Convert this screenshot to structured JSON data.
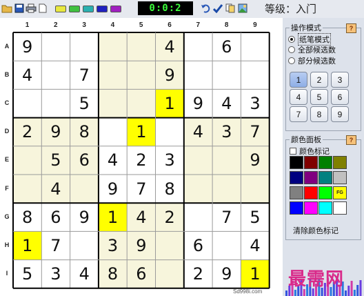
{
  "toolbar": {
    "icons": [
      "open-folder-icon",
      "save-icon",
      "print-icon",
      "new-page-icon"
    ],
    "swatches": [
      "#e8e840",
      "#40c040",
      "#2ab0b0",
      "#2020c0",
      "#a020c0"
    ],
    "tools": [
      "undo-icon",
      "check-icon",
      "copy-icon",
      "image-icon"
    ]
  },
  "timer": {
    "value": "0:0:2"
  },
  "level": {
    "text": "等级：入门"
  },
  "board": {
    "col_labels": [
      "1",
      "2",
      "3",
      "4",
      "5",
      "6",
      "7",
      "8",
      "9"
    ],
    "row_labels": [
      "A",
      "B",
      "C",
      "D",
      "E",
      "F",
      "G",
      "H",
      "I"
    ],
    "cells": [
      [
        "9",
        "",
        "",
        "",
        "",
        "4",
        "",
        "6",
        ""
      ],
      [
        "4",
        "",
        "7",
        "",
        "",
        "9",
        "",
        "",
        ""
      ],
      [
        "",
        "",
        "5",
        "",
        "",
        "1",
        "9",
        "4",
        "3"
      ],
      [
        "2",
        "9",
        "8",
        "",
        "1",
        "",
        "4",
        "3",
        "7"
      ],
      [
        "",
        "5",
        "6",
        "4",
        "2",
        "3",
        "",
        "",
        "9"
      ],
      [
        "",
        "4",
        "",
        "9",
        "7",
        "8",
        "",
        "",
        ""
      ],
      [
        "8",
        "6",
        "9",
        "1",
        "4",
        "2",
        "",
        "7",
        "5"
      ],
      [
        "1",
        "7",
        "",
        "3",
        "9",
        "",
        "6",
        "",
        "4"
      ],
      [
        "5",
        "3",
        "4",
        "8",
        "6",
        "",
        "2",
        "9",
        "1"
      ]
    ],
    "highlight_cells": [
      [
        2,
        5
      ],
      [
        3,
        4
      ],
      [
        6,
        3
      ],
      [
        7,
        0
      ],
      [
        8,
        8
      ]
    ],
    "highlight_color": "#ffff00",
    "box_shade_color": "#f7f5dc",
    "watermark": "Sd998i.com"
  },
  "op_mode": {
    "title": "操作模式",
    "help": "?",
    "options": [
      "纸笔模式",
      "全部候选数",
      "部分候选数"
    ],
    "selected": 0,
    "numbers": [
      "1",
      "2",
      "3",
      "4",
      "5",
      "6",
      "7",
      "8",
      "9"
    ],
    "active_number": 0
  },
  "color_panel": {
    "title": "颜色面板",
    "help": "?",
    "checkbox_label": "颜色标记",
    "colors": [
      "#000000",
      "#800000",
      "#008000",
      "#808000",
      "#000080",
      "#800080",
      "#008080",
      "#c0c0c0",
      "#808080",
      "#ff0000",
      "#00ff00",
      "#ffff00",
      "#0000ff",
      "#ff00ff",
      "#00ffff",
      "#ffffff"
    ],
    "fg_label": "FG",
    "clear_label": "清除颜色标记"
  },
  "site_watermark": "最需网"
}
